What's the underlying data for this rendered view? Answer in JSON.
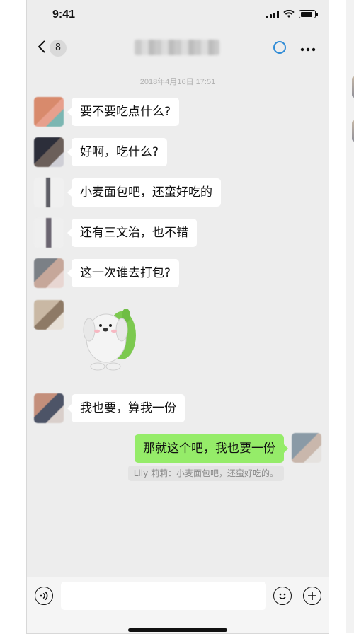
{
  "status": {
    "time": "9:41"
  },
  "nav": {
    "unread_count": "8"
  },
  "chat": {
    "timestamp": "2018年4月16日 17:51",
    "messages": [
      {
        "text": "要不要吃点什么?"
      },
      {
        "text": "好啊，吃什么?"
      },
      {
        "text": "小麦面包吧，还蛮好吃的"
      },
      {
        "text": "还有三文治，也不错"
      },
      {
        "text": "这一次谁去打包?"
      },
      {
        "text": "我也要，算我一份"
      },
      {
        "text": "那就这个吧，我也要一份"
      }
    ],
    "quote": "Lily 莉莉：小麦面包吧，还蛮好吃的。"
  },
  "icons": {
    "back": "chevron-left-icon",
    "status": "loading-ring-icon",
    "more": "more-icon",
    "voice": "voice-icon",
    "emoji": "emoji-icon",
    "plus": "plus-icon"
  },
  "colors": {
    "self_bubble": "#95ec69",
    "other_bubble": "#ffffff",
    "background": "#ededed"
  }
}
